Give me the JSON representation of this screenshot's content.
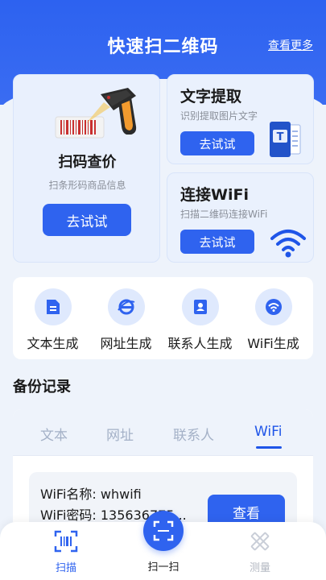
{
  "header": {
    "title": "快速扫二维码",
    "more_link": "查看更多"
  },
  "cards": {
    "scan_price": {
      "title": "扫码查价",
      "subtitle": "扫条形码商品信息",
      "button": "去试试"
    },
    "ocr": {
      "title": "文字提取",
      "subtitle": "识别提取图片文字",
      "button": "去试试"
    },
    "wifi": {
      "title": "连接WiFi",
      "subtitle": "扫描二维码连接WiFi",
      "button": "去试试"
    }
  },
  "generators": [
    {
      "label": "文本生成",
      "icon": "document-icon"
    },
    {
      "label": "网址生成",
      "icon": "browser-icon"
    },
    {
      "label": "联系人生成",
      "icon": "contact-book-icon"
    },
    {
      "label": "WiFi生成",
      "icon": "wifi-icon"
    }
  ],
  "backup": {
    "title": "备份记录",
    "tabs": [
      "文本",
      "网址",
      "联系人",
      "WiFi"
    ],
    "active_tab": "WiFi",
    "record": {
      "name_line": "WiFi名称: whwifi",
      "password_line": "WiFi密码: 135636775...",
      "button": "查看"
    }
  },
  "bottom_nav": {
    "scan": "扫描",
    "scan_one": "扫一扫",
    "measure": "测量"
  },
  "colors": {
    "primary": "#2f63ef",
    "background": "#eef3fb",
    "inactive_tab": "#a4b1c7"
  }
}
